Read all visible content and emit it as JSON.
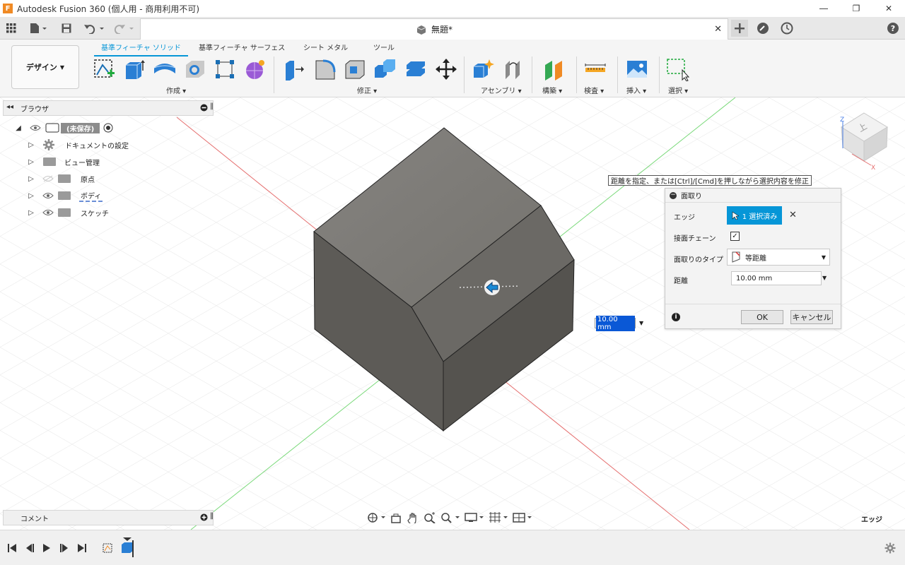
{
  "window": {
    "title": "Autodesk Fusion 360 (個人用 - 商用利用不可)",
    "app_icon_letter": "F"
  },
  "appbar": {
    "document_title": "無題*"
  },
  "ribbon": {
    "workspace_label": "デザイン",
    "tabs": [
      "基準フィーチャ ソリッド",
      "基準フィーチャ サーフェス",
      "シート メタル",
      "ツール"
    ],
    "active_tab": "基準フィーチャ ソリッド",
    "groups": [
      "作成",
      "修正",
      "アセンブリ",
      "構築",
      "検査",
      "挿入",
      "選択"
    ]
  },
  "browser": {
    "label": "ブラウザ",
    "root": "(未保存)",
    "items": [
      "ドキュメントの設定",
      "ビュー管理",
      "原点",
      "ボディ",
      "スケッチ"
    ]
  },
  "prompt": "距離を指定、または[Ctrl]/[Cmd]を押しながら選択内容を修正",
  "dialog": {
    "title": "面取り",
    "edge_label": "エッジ",
    "edge_selection": "1 選択済み",
    "chain_label": "接面チェーン",
    "chain_checked": true,
    "type_label": "面取りのタイプ",
    "type_value": "等距離",
    "distance_label": "距離",
    "distance_value": "10.00 mm",
    "ok_label": "OK",
    "cancel_label": "キャンセル"
  },
  "canvas_input": {
    "value": "10.00 mm"
  },
  "viewcube": {
    "face": "上",
    "axis_z": "Z",
    "axis_x": "X"
  },
  "comment_label": "コメント",
  "selection_filter": "エッジ",
  "colors": {
    "accent": "#0696d7",
    "solid_top": "#7d7b76",
    "solid_chamfer": "#6a6864",
    "solid_left": "#5c5a56",
    "solid_right": "#53514d",
    "axis_red": "#e05050",
    "axis_green": "#5ccc5c"
  }
}
